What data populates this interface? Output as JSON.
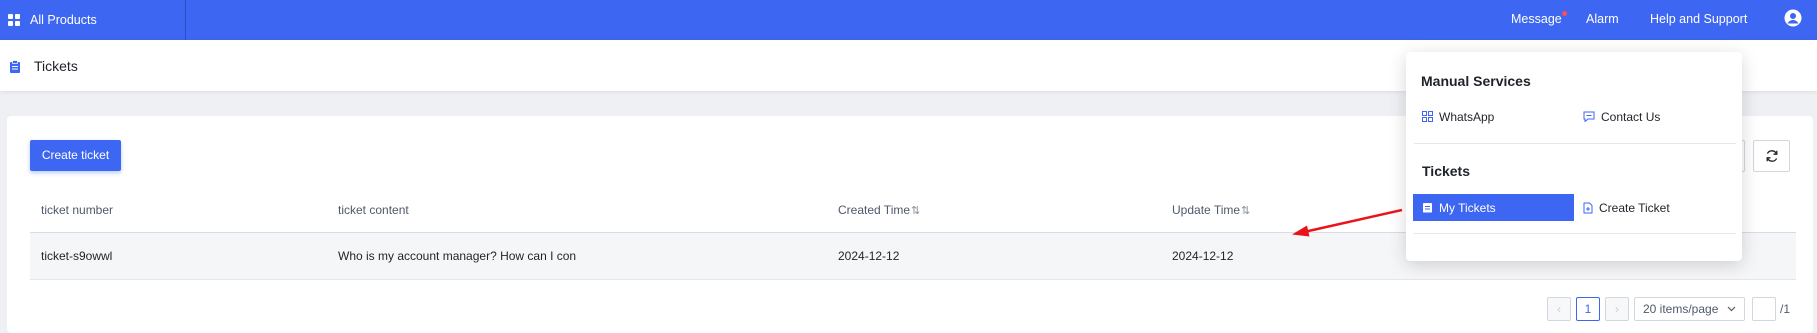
{
  "topbar": {
    "all_products": "All Products",
    "message": "Message",
    "alarm": "Alarm",
    "help_support": "Help and Support",
    "accent_color": "#3d66f2"
  },
  "page": {
    "title": "Tickets"
  },
  "toolbar": {
    "create_ticket": "Create ticket"
  },
  "table": {
    "columns": [
      "ticket number",
      "ticket content",
      "Created Time",
      "Update Time"
    ],
    "rows": [
      {
        "ticket_number": "ticket-s9owwl",
        "content": "Who is my account manager? How can I con",
        "created": "2024-12-12",
        "updated": "2024-12-12"
      }
    ]
  },
  "pagination": {
    "prev": "‹",
    "current_page": "1",
    "next": "›",
    "page_size": "20 items/page",
    "total_pages": "/1"
  },
  "dropdown": {
    "manual_services": {
      "heading": "Manual Services",
      "items": [
        "WhatsApp",
        "Contact Us"
      ]
    },
    "tickets": {
      "heading": "Tickets",
      "items": [
        "My Tickets",
        "Create Ticket"
      ],
      "selected": "My Tickets"
    }
  },
  "icons": [
    "grid-icon",
    "user-icon",
    "clipboard-icon",
    "refresh-icon",
    "chat-icon",
    "document-icon",
    "arrow-annotation"
  ]
}
